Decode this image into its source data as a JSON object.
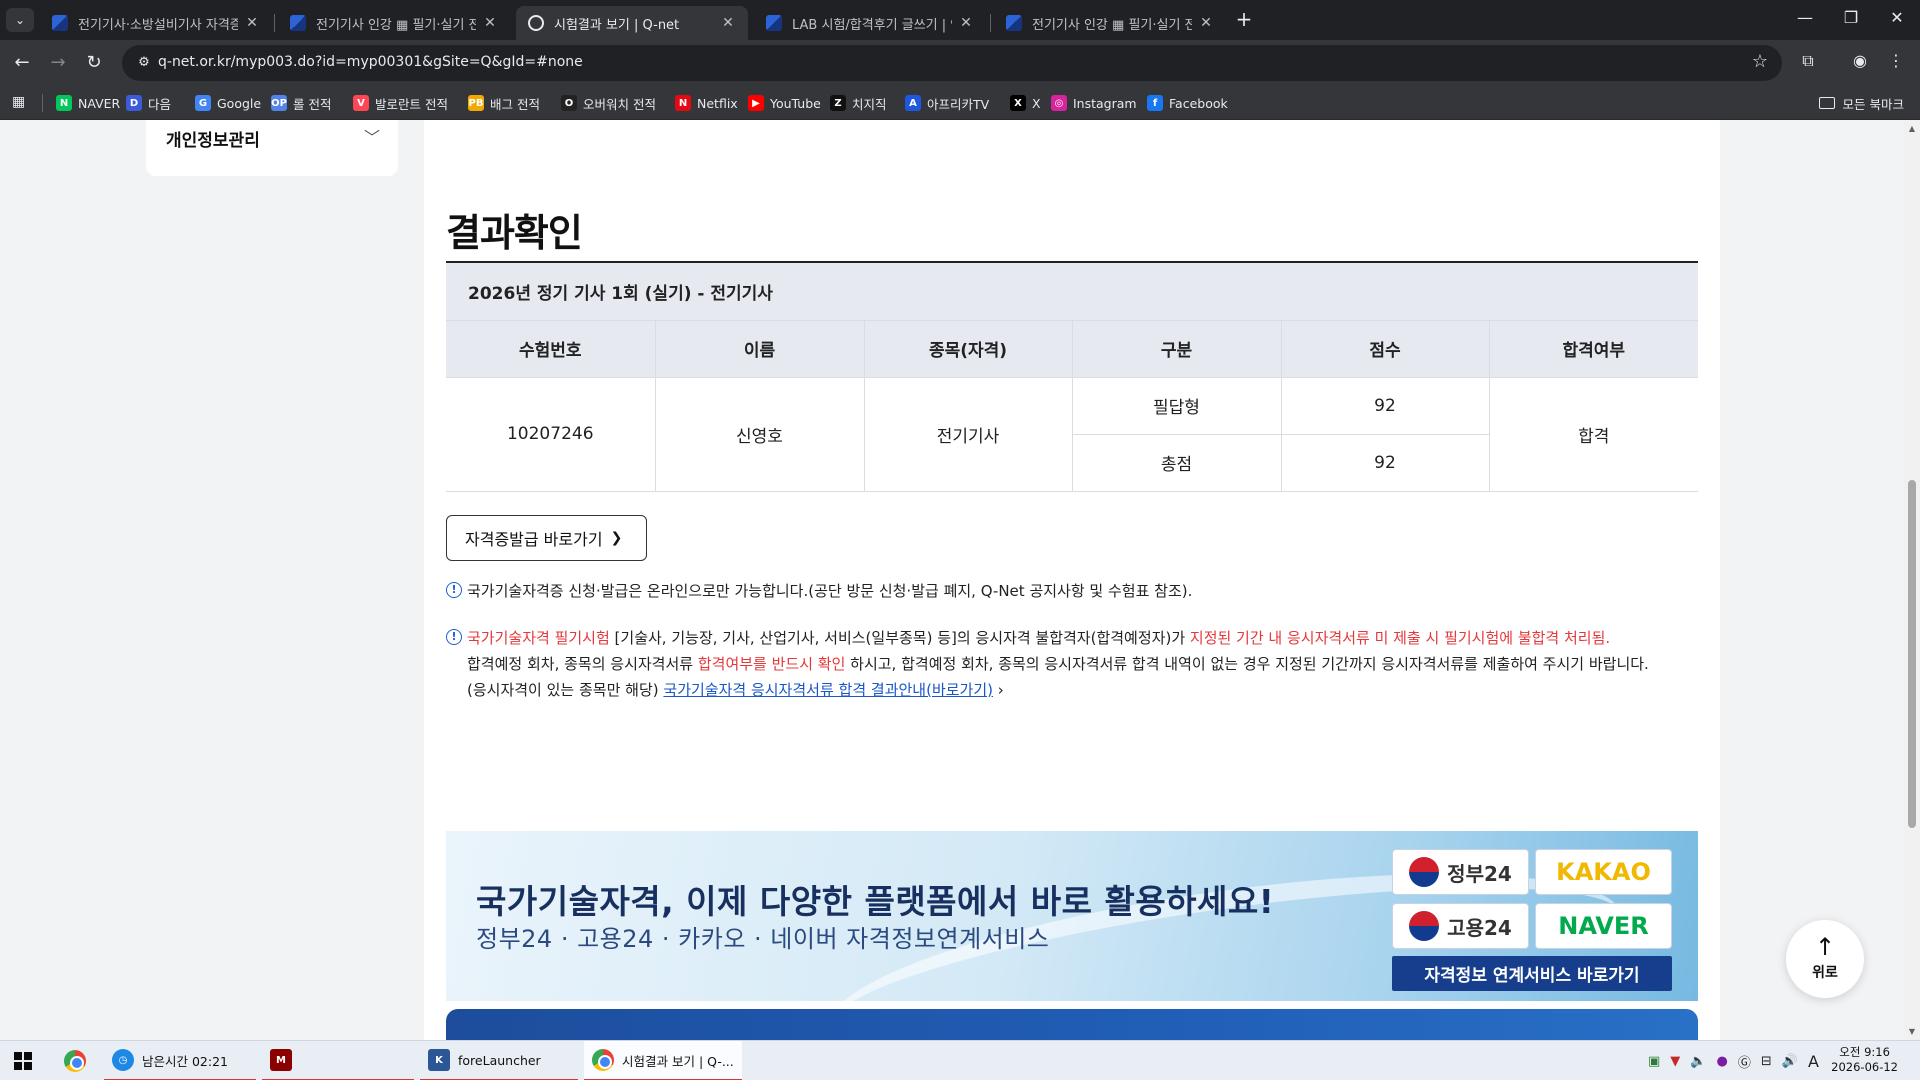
{
  "browser": {
    "tabs": [
      {
        "title": "전기기사·소방설비기사 자격증",
        "active": false
      },
      {
        "title": "전기기사 인강 ▦ 필기·실기 전",
        "active": false
      },
      {
        "title": "시험결과 보기 | Q-net",
        "active": true
      },
      {
        "title": "LAB 시험/합격후기 글쓰기 | 인",
        "active": false
      },
      {
        "title": "전기기사 인강 ▦ 필기·실기 전",
        "active": false
      }
    ],
    "url": "q-net.or.kr/myp003.do?id=myp00301&gSite=Q&gId=#none",
    "bookmarks": [
      {
        "label": "NAVER",
        "icon": "N",
        "color": "#03c75a"
      },
      {
        "label": "다음",
        "icon": "D",
        "color": "#3b5bdb"
      },
      {
        "label": "Google",
        "icon": "G",
        "color": "#4285f4"
      },
      {
        "label": "롤 전적",
        "icon": "OP",
        "color": "#5383e8"
      },
      {
        "label": "발로란트 전적",
        "icon": "V",
        "color": "#ff4655"
      },
      {
        "label": "배그 전적",
        "icon": "PB",
        "color": "#f2a900"
      },
      {
        "label": "오버워치 전적",
        "icon": "O",
        "color": "#222222"
      },
      {
        "label": "Netflix",
        "icon": "N",
        "color": "#e50914"
      },
      {
        "label": "YouTube",
        "icon": "▶",
        "color": "#ff0000"
      },
      {
        "label": "치지직",
        "icon": "Z",
        "color": "#111111"
      },
      {
        "label": "아프리카TV",
        "icon": "A",
        "color": "#1f58e0"
      },
      {
        "label": "X",
        "icon": "X",
        "color": "#000000"
      },
      {
        "label": "Instagram",
        "icon": "◎",
        "color": "#d6249f"
      },
      {
        "label": "Facebook",
        "icon": "f",
        "color": "#1877f2"
      }
    ],
    "bookmarks_folder": "모든 북마크"
  },
  "sidebar": {
    "personal_info": "개인정보관리"
  },
  "page": {
    "title": "결과확인",
    "exam_caption": "2026년 정기 기사 1회 (실기) - 전기기사",
    "table": {
      "headers": [
        "수험번호",
        "이름",
        "종목(자격)",
        "구분",
        "점수",
        "합격여부"
      ],
      "exam_no": "10207246",
      "name": "신영호",
      "item": "전기기사",
      "rows": [
        {
          "type": "필답형",
          "score": "92"
        },
        {
          "type": "총점",
          "score": "92"
        }
      ],
      "result": "합격"
    },
    "issue_button": "자격증발급 바로가기",
    "notice1": "국가기술자격증 신청·발급은 온라인으로만 가능합니다.(공단 방문 신청·발급 폐지, Q-Net 공지사항 및 수험표 참조).",
    "notice2": {
      "l1_red1": "국가기술자격 필기시험",
      "l1_mid": " [기술사, 기능장, 기사, 산업기사, 서비스(일부종목) 등]의 응시자격 불합격자(합격예정자)가 ",
      "l1_red2": "지정된 기간 내 응시자격서류 미 제출 시 필기시험에 불합격 처리됨.",
      "l2_a": "합격예정 회차, 종목의 응시자격서류 ",
      "l2_red": "합격여부를 반드시 확인",
      "l2_b": " 하시고, 합격예정 회차, 종목의 응시자격서류 합격 내역이 없는 경우 지정된 기간까지 응시자격서류를 제출하여 주시기 바랍니다.",
      "l3_a": "(응시자격이 있는 종목만 해당) ",
      "l3_link": "국가기술자격 응시자격서류 합격 결과안내(바로가기)"
    },
    "banner": {
      "headline": "국가기술자격, 이제 다양한 플랫폼에서 바로 활용하세요!",
      "sub": "정부24 · 고용24 · 카카오 · 네이버 자격정보연계서비스",
      "badges": [
        "정부24",
        "KAKAO",
        "고용24",
        "NAVER"
      ],
      "cta": "자격정보 연계서비스 바로가기"
    },
    "top_button": "위로"
  },
  "taskbar": {
    "items": [
      {
        "label": "남은시간 02:21"
      },
      {
        "label": ""
      },
      {
        "label": "foreLauncher"
      },
      {
        "label": "시험결과 보기 | Q-..."
      }
    ],
    "time": "오전 9:16",
    "date": "2026-06-12",
    "ime": "A"
  }
}
